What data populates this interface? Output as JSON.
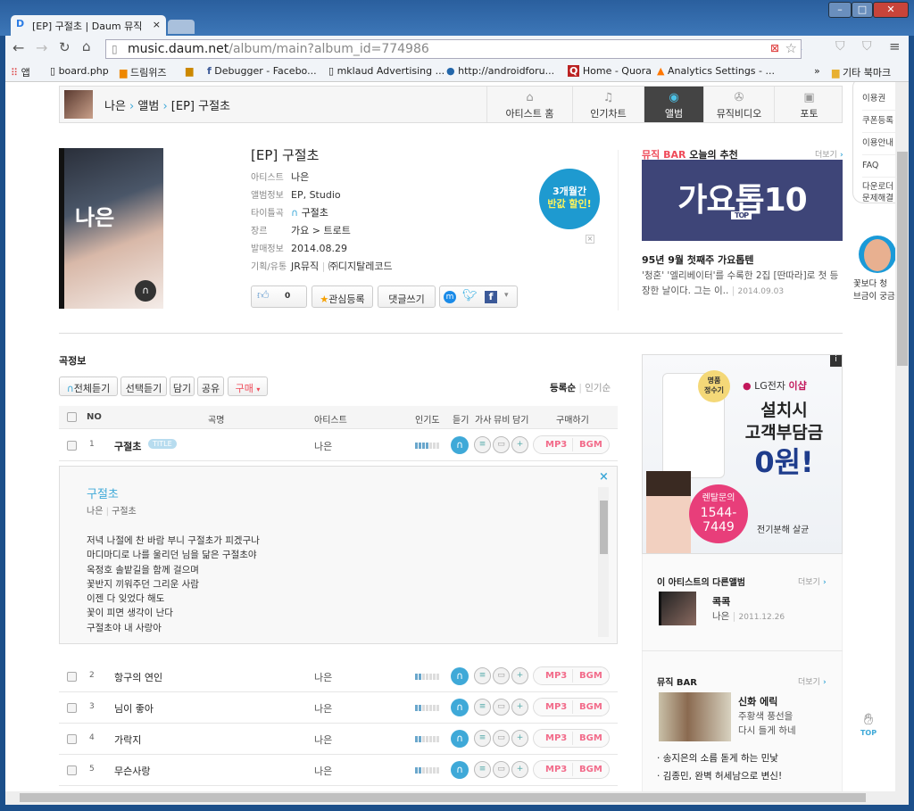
{
  "browser": {
    "tab_title": "[EP] 구절초 | Daum 뮤직",
    "url_domain": "music.daum.net",
    "url_path": "/album/main?album_id=774986",
    "bookmarks": [
      "앱",
      "board.php",
      "드림위즈",
      "Debugger - Facebo...",
      "mklaud Advertising ...",
      "http://androidforu...",
      "Home - Quora",
      "Analytics Settings - ..."
    ],
    "other_bookmarks": "기타 북마크"
  },
  "nav": {
    "breadcrumb": [
      "나은",
      "앨범",
      "[EP] 구절초"
    ],
    "tabs": [
      {
        "label": "아티스트 홈",
        "icon": "home-icon"
      },
      {
        "label": "인기차트",
        "icon": "music-note-icon"
      },
      {
        "label": "앨범",
        "icon": "disc-icon",
        "active": true
      },
      {
        "label": "뮤직비디오",
        "icon": "film-icon"
      },
      {
        "label": "포토",
        "icon": "camera-icon"
      }
    ]
  },
  "album": {
    "title": "[EP] 구절초",
    "cover_text": "나은",
    "info": [
      {
        "label": "아티스트",
        "value": "나은"
      },
      {
        "label": "앨범정보",
        "value": "EP, Studio"
      },
      {
        "label": "타이틀곡",
        "value": "구절초"
      },
      {
        "label": "장르",
        "value": "가요 > 트로트"
      },
      {
        "label": "발매정보",
        "value": "2014.08.29"
      },
      {
        "label": "기획/유통",
        "value": "JR뮤직",
        "value2": "㈜디지탈레코드"
      }
    ],
    "like_count": "0",
    "follow_label": "관심등록",
    "comment_label": "댓글쓰기",
    "promo": [
      "3개월간",
      "반값 할인!"
    ]
  },
  "recommend": {
    "title_red": "뮤직 BAR",
    "title": "오늘의 추천",
    "more": "더보기",
    "banner_text": "가요톱10",
    "banner_sub": "TOP",
    "headline": "95년 9월 첫째주 가요톱텐",
    "desc": "'청혼' '엘리베이터'를 수록한 2집 [딴따라]로 첫 등장한 날이다. 그는 이..",
    "date": "2014.09.03"
  },
  "tracks": {
    "section_title": "곡정보",
    "buttons": [
      "전체듣기",
      "선택듣기",
      "담기",
      "공유",
      "구매"
    ],
    "sort": [
      "등록순",
      "인기순"
    ],
    "headers": [
      "NO",
      "곡명",
      "아티스트",
      "인기도",
      "듣기",
      "가사",
      "뮤비",
      "담기",
      "구매하기"
    ],
    "title_badge": "TITLE",
    "buy": [
      "MP3",
      "BGM"
    ],
    "rows": [
      {
        "no": "1",
        "title": "구절초",
        "artist": "나은",
        "popularity": 0.57,
        "title_track": true
      },
      {
        "no": "2",
        "title": "항구의 연인",
        "artist": "나은",
        "popularity": 0.29
      },
      {
        "no": "3",
        "title": "님이 좋아",
        "artist": "나은",
        "popularity": 0.29
      },
      {
        "no": "4",
        "title": "가락지",
        "artist": "나은",
        "popularity": 0.29
      },
      {
        "no": "5",
        "title": "무슨사랑",
        "artist": "나은",
        "popularity": 0.29
      }
    ],
    "lyrics": {
      "title": "구절초",
      "artist": "나은",
      "album": "구절초",
      "lines": [
        "저녁 나절에 찬 바람 부니 구절초가 피겠구나",
        "마디마디로 나를 울리던 님을 닮은 구절초야",
        "옥정호 솔밭길을 함께 걸으며",
        "꽃반지 끼워주던 그리운 사람",
        "이젠 다 잊었다 해도",
        "꽃이 피면 생각이 난다",
        "구절초야 내 사랑아"
      ]
    }
  },
  "ad": {
    "brand": "LG전자",
    "brand_red": "이샵",
    "badge": [
      "명품",
      "정수기"
    ],
    "line1": "설치시",
    "line2": "고객부담금",
    "line3": "0원!",
    "contact_label": "렌탈문의",
    "phone1": "1544-",
    "phone2": "7449",
    "feature": "전기분해 살균"
  },
  "other_albums": {
    "title": "이 아티스트의 다른앨범",
    "more": "더보기",
    "items": [
      {
        "title": "콕콕",
        "artist": "나은",
        "date": "2011.12.26"
      }
    ]
  },
  "music_bar": {
    "title": "뮤직 BAR",
    "more": "더보기",
    "feature_title": "신화 에릭",
    "feature_desc": [
      "주황색 풍선을",
      "다시 들게 하네"
    ],
    "items": [
      "송지은의 소름 돋게 하는 민낯",
      "김종민, 완벽 허세남으로 변신!"
    ]
  },
  "side_menu": {
    "items": [
      "이용권",
      "쿠폰등록",
      "이용안내",
      "FAQ",
      "다운로더 문제해결"
    ],
    "promo_caption": [
      "꽃보다 청",
      "브금이 궁금"
    ],
    "top_label": "TOP"
  }
}
